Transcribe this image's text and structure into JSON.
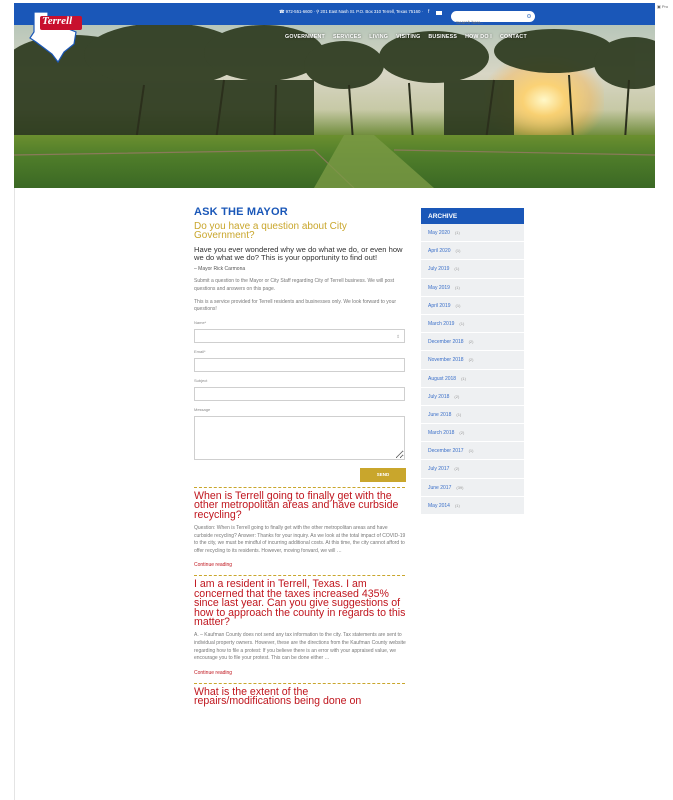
{
  "header": {
    "contact": "☎ 972-551-6600 · ⚲ 201 East Nash St. P.O. Box 310 Terrell, Texas 75160 ·",
    "facebook_icon": "facebook-icon",
    "mail_icon": "mail-icon",
    "search_placeholder": "Search here..",
    "language": "▣ Pro"
  },
  "logo": {
    "text": "Terrell",
    "sub": "AMERICA"
  },
  "nav": [
    "GOVERNMENT",
    "SERVICES",
    "LIVING",
    "VISITING",
    "BUSINESS",
    "HOW DO I",
    "CONTACT"
  ],
  "main": {
    "title": "ASK THE MAYOR",
    "question": "Do you have a question about City Government?",
    "intro": "Have you ever wondered why we do what we do, or even how we do what we do? This is your opportunity to find out!",
    "signature": "– Mayor Rick Carmona",
    "para1": "Submit a question to the Mayor or City Staff regarding City of Terrell business. We will post questions and answers on this page.",
    "para2": "This is a service provided for Terrell residents and businesses only. We look forward to your questions!",
    "form": {
      "name_label": "Name*",
      "email_label": "Email*",
      "subject_label": "Subject",
      "message_label": "Message",
      "send_label": "SEND"
    }
  },
  "posts": [
    {
      "title": "When is Terrell going to finally get with the other metropolitan areas and have curbside recycling?",
      "excerpt": "Question: When is Terrell going to finally get with the other metropolitan areas and have curbside recycling? Answer: Thanks for your inquiry. As we look at the total impact of COVID-19 to the city, we must be mindful of incurring additional costs. At this time, the city cannot afford to offer recycling to its residents. However, moving forward, we will …",
      "link": "Continue reading"
    },
    {
      "title": "I am a resident in Terrell, Texas. I am concerned that the taxes increased 435% since last year. Can you give suggestions of how to approach the county in regards to this matter?",
      "excerpt": "A. – Kaufman County does not send any tax information to the city. Tax statements are sent to individual property owners. However, these are the directions from the Kaufman County website regarding how to file a protest: If you believe there is an error with your appraised value, we encourage you to file your protest. This can be done either …",
      "link": "Continue reading"
    },
    {
      "title": "What is the extent of the repairs/modifications being done on"
    }
  ],
  "sidebar": {
    "heading": "ARCHIVE",
    "items": [
      {
        "label": "May 2020",
        "count": "(1)"
      },
      {
        "label": "April 2020",
        "count": "(1)"
      },
      {
        "label": "July 2019",
        "count": "(1)"
      },
      {
        "label": "May 2019",
        "count": "(1)"
      },
      {
        "label": "April 2019",
        "count": "(1)"
      },
      {
        "label": "March 2019",
        "count": "(1)"
      },
      {
        "label": "December 2018",
        "count": "(2)"
      },
      {
        "label": "November 2018",
        "count": "(2)"
      },
      {
        "label": "August 2018",
        "count": "(1)"
      },
      {
        "label": "July 2018",
        "count": "(2)"
      },
      {
        "label": "June 2018",
        "count": "(1)"
      },
      {
        "label": "March 2018",
        "count": "(2)"
      },
      {
        "label": "December 2017",
        "count": "(1)"
      },
      {
        "label": "July 2017",
        "count": "(2)"
      },
      {
        "label": "June 2017",
        "count": "(39)"
      },
      {
        "label": "May 2014",
        "count": "(1)"
      }
    ]
  }
}
